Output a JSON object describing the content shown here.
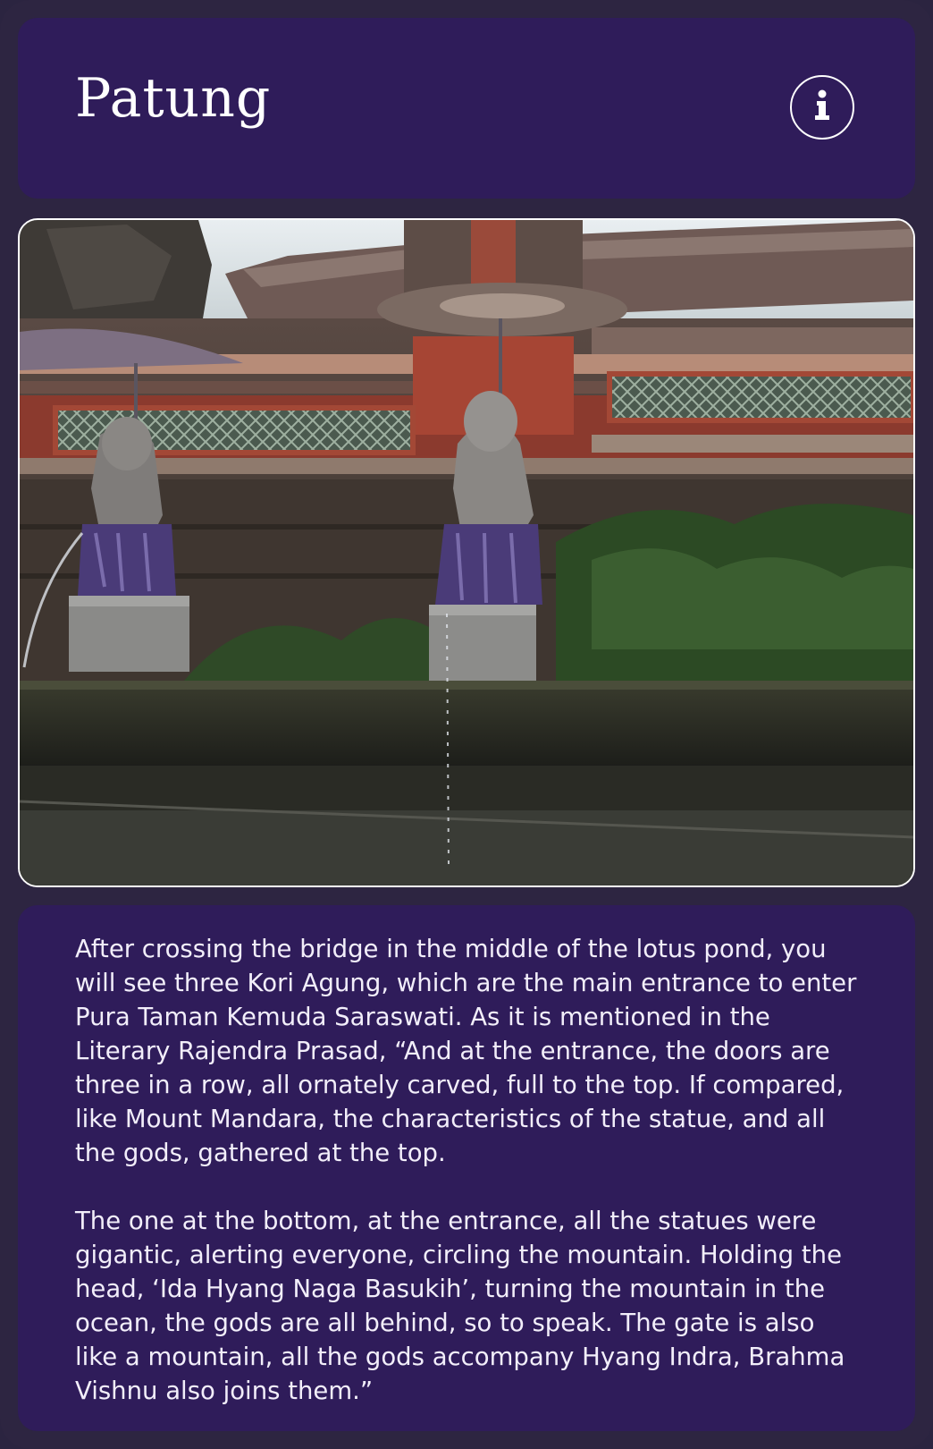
{
  "header": {
    "title": "Patung"
  },
  "icons": {
    "info": "info-icon"
  },
  "photo": {
    "subject": "temple statues photo"
  },
  "description": {
    "paragraphs": [
      "After crossing the bridge in the middle of the lotus pond, you will see three Kori Agung, which are the main entrance to enter Pura Taman Kemuda Saraswati. As it is mentioned in the Literary Rajendra Prasad, “And at the entrance, the doors are three in a row, all ornately carved, full to the top. If compared, like Mount Mandara, the characteristics of the statue, and all the gods, gathered at the top.",
      "The one at the bottom, at the entrance, all the statues were gigantic, alerting everyone, circling the mountain. Holding the head, ‘Ida Hyang Naga Basukih’, turning the mountain in the ocean, the gods are all behind, so to speak. The gate is also like a mountain, all the gods accompany Hyang Indra, Brahma Vishnu also joins them.”"
    ]
  },
  "colors": {
    "page_background": "#2d2541",
    "panel": "#2f1c5a",
    "text": "#f2eefa",
    "outline": "#ffffff"
  }
}
